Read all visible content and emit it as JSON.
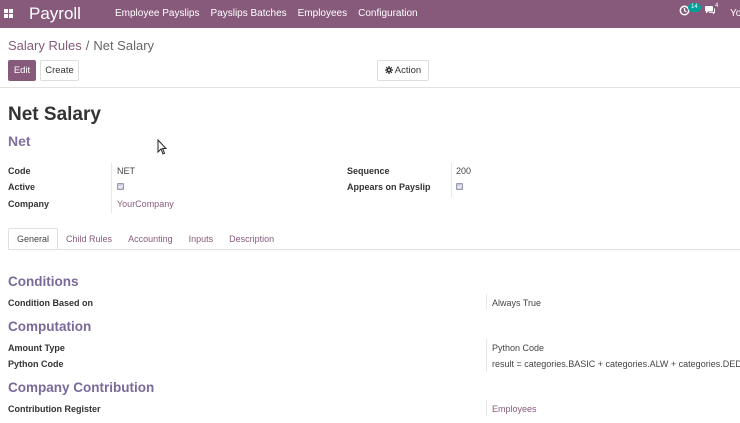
{
  "navbar": {
    "brand": "Payroll",
    "menu": [
      "Employee Payslips",
      "Payslips Batches",
      "Employees",
      "Configuration"
    ],
    "activity_count": "14",
    "messages_count": "4",
    "user_label": "Yo"
  },
  "breadcrumb": {
    "parent": "Salary Rules",
    "separator": "/",
    "current": "Net Salary"
  },
  "buttons": {
    "edit": "Edit",
    "create": "Create",
    "action": "Action"
  },
  "record": {
    "name": "Net Salary",
    "code_title": "Net",
    "fields": {
      "code_label": "Code",
      "code_value": "NET",
      "active_label": "Active",
      "active_checked": true,
      "company_label": "Company",
      "company_value": "YourCompany",
      "sequence_label": "Sequence",
      "sequence_value": "200",
      "appears_label": "Appears on Payslip",
      "appears_checked": true
    }
  },
  "tabs": [
    "General",
    "Child Rules",
    "Accounting",
    "Inputs",
    "Description"
  ],
  "general": {
    "conditions_title": "Conditions",
    "condition_label": "Condition Based on",
    "condition_value": "Always True",
    "computation_title": "Computation",
    "amount_type_label": "Amount Type",
    "amount_type_value": "Python Code",
    "python_code_label": "Python Code",
    "python_code_value": "result = categories.BASIC + categories.ALW + categories.DED",
    "contribution_title": "Company Contribution",
    "contribution_label": "Contribution Register",
    "contribution_value": "Employees"
  },
  "colors": {
    "navbar": "#875a7b",
    "accent": "#875a7b",
    "section": "#7a6a9a",
    "badge": "#00a09d"
  }
}
